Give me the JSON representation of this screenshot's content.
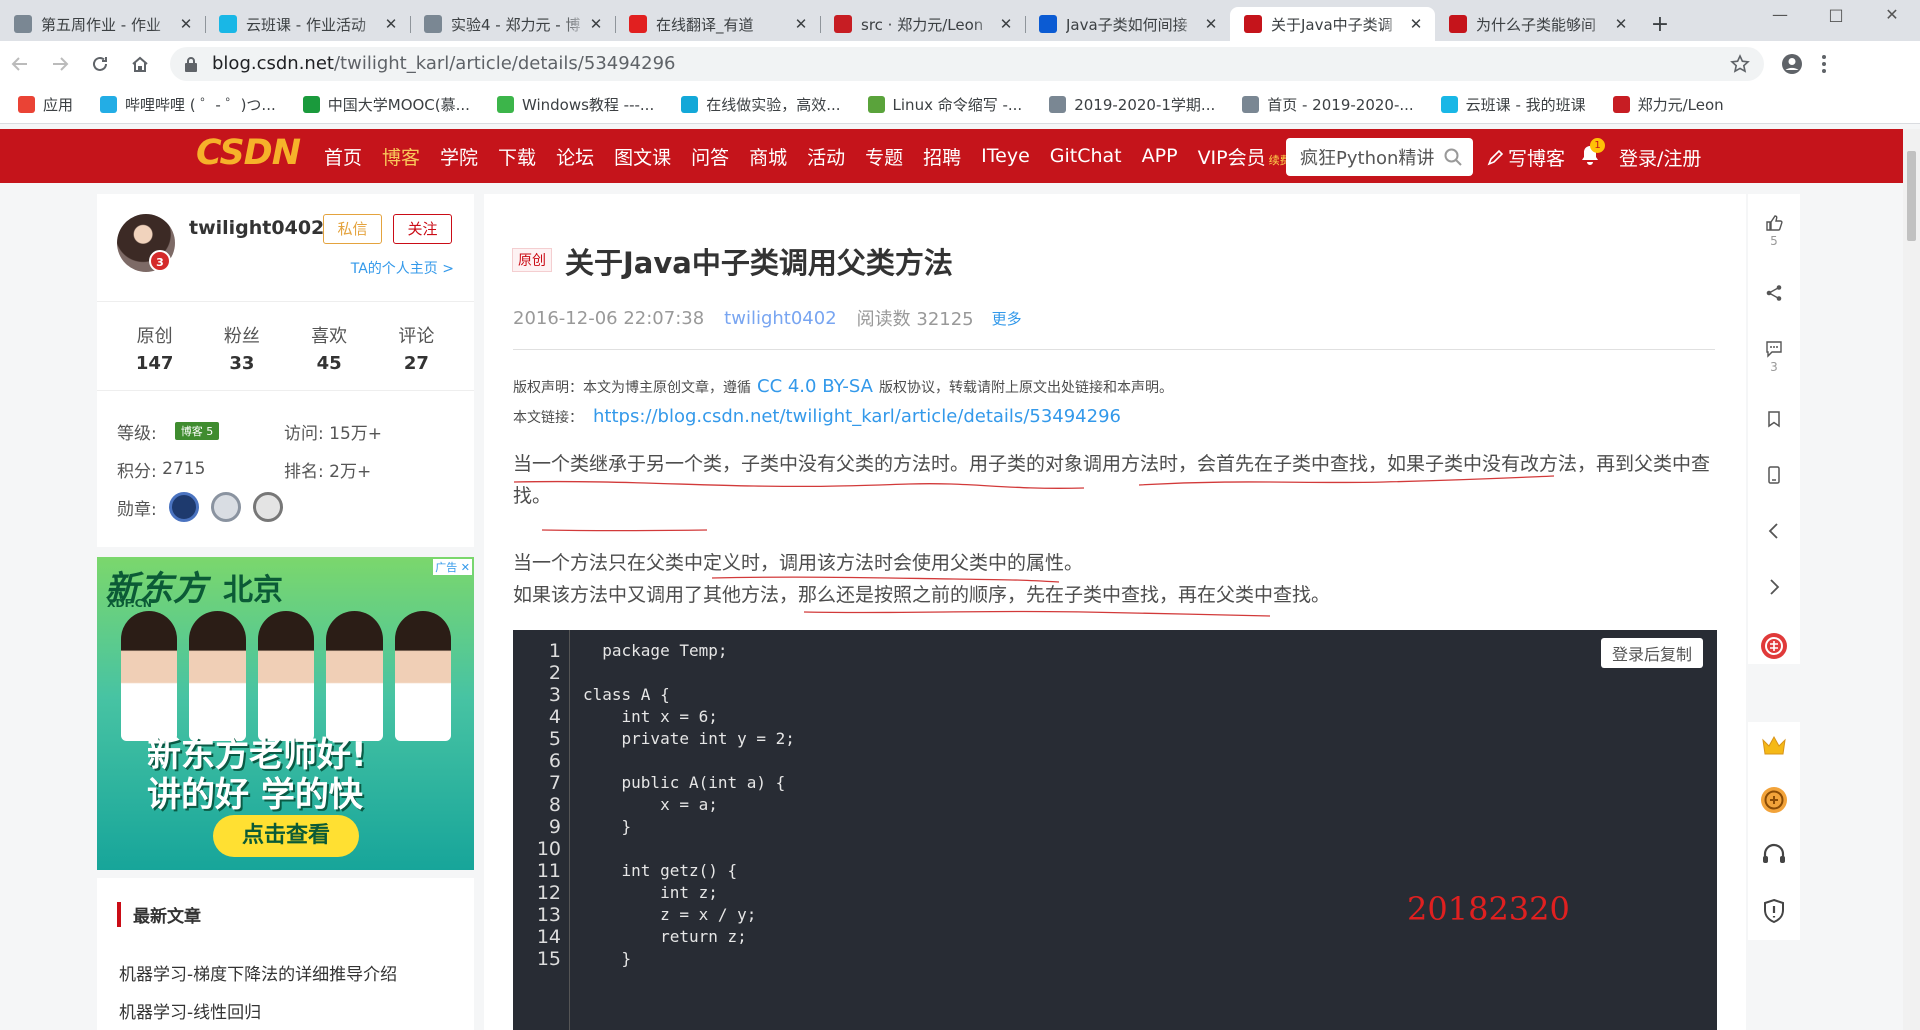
{
  "browser": {
    "tabs": [
      {
        "title": "第五周作业 - 作业",
        "icon": "cloud-icon",
        "color": "#7a8793",
        "active": false
      },
      {
        "title": "云班课 - 作业活动",
        "icon": "cloud-class-icon",
        "color": "#19b7e6",
        "active": false
      },
      {
        "title": "实验4 - 郑力元 - 博",
        "icon": "cloud-icon",
        "color": "#7a8793",
        "active": false
      },
      {
        "title": "在线翻译_有道",
        "icon": "youdao-icon",
        "color": "#e12020",
        "active": false
      },
      {
        "title": "src · 郑力元/Leon",
        "icon": "gitee-icon",
        "color": "#c71d23",
        "active": false
      },
      {
        "title": "Java子类如何间接",
        "icon": "bing-icon",
        "color": "#0b5bd3",
        "active": false
      },
      {
        "title": "关于Java中子类调",
        "icon": "csdn-icon",
        "color": "#c5141b",
        "active": true
      },
      {
        "title": "为什么子类能够间",
        "icon": "csdn-icon",
        "color": "#c5141b",
        "active": false
      }
    ],
    "url_host": "blog.csdn.net",
    "url_path": "/twilight_karl/article/details/53494296",
    "bookmarks": [
      {
        "label": "应用",
        "color": "#ea4335"
      },
      {
        "label": "哔哩哔哩 ( ゜- ゜)つ...",
        "color": "#23ade5"
      },
      {
        "label": "中国大学MOOC(慕...",
        "color": "#1a9a3c"
      },
      {
        "label": "Windows教程 ---...",
        "color": "#3cb54a"
      },
      {
        "label": "在线做实验，高效...",
        "color": "#13a8d8"
      },
      {
        "label": "Linux 命令缩写 -...",
        "color": "#5aa33b"
      },
      {
        "label": "2019-2020-1学期...",
        "color": "#7a8793"
      },
      {
        "label": "首页 - 2019-2020-...",
        "color": "#7a8793"
      },
      {
        "label": "云班课 - 我的班课",
        "color": "#19b7e6"
      },
      {
        "label": "郑力元/Leon",
        "color": "#c71d23"
      }
    ]
  },
  "site": {
    "logo": "CSDN",
    "nav": [
      "首页",
      "博客",
      "学院",
      "下载",
      "论坛",
      "图文课",
      "问答",
      "商城",
      "活动",
      "专题",
      "招聘",
      "ITeye",
      "GitChat",
      "APP",
      "VIP会员"
    ],
    "nav_active": "博客",
    "vip_badge": "续费8折",
    "search_placeholder": "疯狂Python精讲",
    "write": "写博客",
    "notifications": "1",
    "login": "登录/注册"
  },
  "profile": {
    "username": "twilight0402",
    "years_badge": "3",
    "message_btn": "私信",
    "follow_btn": "关注",
    "home_link": "TA的个人主页 >",
    "stats": [
      {
        "label": "原创",
        "value": "147"
      },
      {
        "label": "粉丝",
        "value": "33"
      },
      {
        "label": "喜欢",
        "value": "45"
      },
      {
        "label": "评论",
        "value": "27"
      }
    ],
    "level_label": "等级:",
    "level_badge": "博客 5",
    "visits_label": "访问:",
    "visits": "15万+",
    "points_label": "积分:",
    "points": "2715",
    "rank_label": "排名:",
    "rank": "2万+",
    "medals_label": "勋章:"
  },
  "ad": {
    "brand": "新东方",
    "brand_sub": "XDF.CN",
    "city": "北京",
    "tag": "广告",
    "line1": "新东方老师好!",
    "line2": "讲的好 学的快",
    "cta": "点击查看"
  },
  "recent": {
    "heading": "最新文章",
    "items": [
      "机器学习-梯度下降法的详细推导介绍",
      "机器学习-线性回归"
    ]
  },
  "article": {
    "tag": "原创",
    "title": "关于Java中子类调用父类方法",
    "date": "2016-12-06 22:07:38",
    "author": "twilight0402",
    "reads": "阅读数 32125",
    "more": "更多",
    "copyright_pre": "版权声明：本文为博主原创文章，遵循",
    "license": "CC 4.0 BY-SA",
    "copyright_post": "版权协议，转载请附上原文出处链接和本声明。",
    "link_label": "本文链接：",
    "link": "https://blog.csdn.net/twilight_karl/article/details/53494296",
    "p1": "当一个类继承于另一个类，子类中没有父类的方法时。用子类的对象调用方法时，会首先在子类中查找，如果子类中没有改方法，再到父类中查找。",
    "p2": "当一个方法只在父类中定义时，调用该方法时会使用父类中的属性。",
    "p3": "如果该方法中又调用了其他方法，那么还是按照之前的顺序，先在子类中查找，再在父类中查找。",
    "copy_btn": "登录后复制",
    "watermark": "20182320",
    "code_lines": [
      "  package Temp;",
      "",
      "class A {",
      "    int x = 6;",
      "    private int y = 2;",
      "",
      "    public A(int a) {",
      "        x = a;",
      "    }",
      "",
      "    int getz() {",
      "        int z;",
      "        z = x / y;",
      "        return z;",
      "    }"
    ],
    "line_numbers": [
      "1",
      "2",
      "3",
      "4",
      "5",
      "6",
      "7",
      "8",
      "9",
      "10",
      "11",
      "12",
      "13",
      "14",
      "15"
    ]
  },
  "rail": {
    "likes": "5",
    "comments": "3"
  },
  "colors": {
    "csdn_red": "#c5141b",
    "link_blue": "#3399ea",
    "code_bg": "#282c34"
  }
}
